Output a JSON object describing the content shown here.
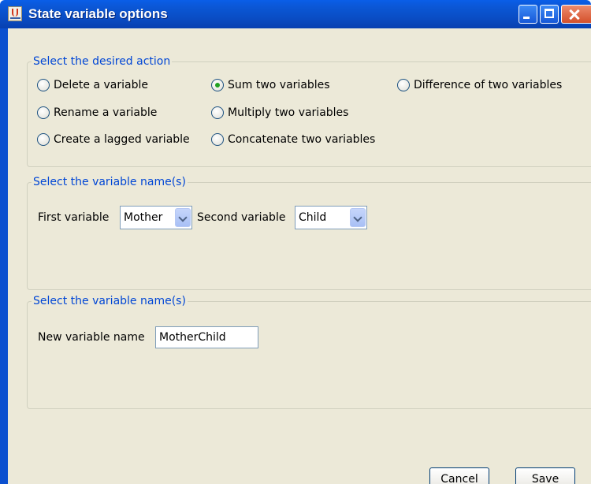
{
  "window": {
    "title": "State variable options",
    "icon": "java-cup-icon"
  },
  "titlebar_buttons": [
    "minimize-icon",
    "maximize-icon",
    "close-icon"
  ],
  "action_group": {
    "legend": "Select the desired action",
    "options": [
      {
        "label": "Delete a variable",
        "checked": false
      },
      {
        "label": "Sum two variables",
        "checked": true
      },
      {
        "label": "Difference of two variables",
        "checked": false
      },
      {
        "label": "Rename a variable",
        "checked": false
      },
      {
        "label": "Multiply two variables",
        "checked": false
      },
      {
        "label": "Create a lagged variable",
        "checked": false
      },
      {
        "label": "Concatenate two variables",
        "checked": false
      }
    ]
  },
  "names_group": {
    "legend": "Select the variable name(s)",
    "first_label": "First variable",
    "first_value": "Mother",
    "second_label": "Second variable",
    "second_value": "Child"
  },
  "new_name_group": {
    "legend": "Select the variable name(s)",
    "field_label": "New variable name",
    "field_value": "MotherChild"
  },
  "buttons": {
    "cancel": "Cancel",
    "save": "Save"
  }
}
